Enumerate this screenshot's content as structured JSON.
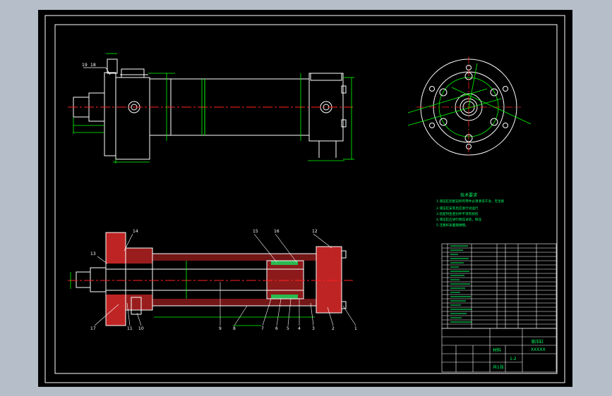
{
  "colors": {
    "window_bg": "#b5bec9",
    "canvas": "#000000",
    "outline": "#ffffff",
    "dimension": "#00ff00",
    "centerline": "#ff2020",
    "hatch": "#ff4040",
    "text_green": "#00ff66",
    "text_white": "#ffffff"
  },
  "top_view_labels": {
    "leader_19": "19",
    "leader_18": "18"
  },
  "section_view_labels": {
    "top": [
      "14",
      "15",
      "16",
      "12"
    ],
    "left": [
      "13"
    ],
    "bottom": [
      "17",
      "11",
      "10",
      "9",
      "8",
      "7",
      "6",
      "5",
      "4",
      "3",
      "2",
      "1"
    ]
  },
  "tech_requirements": {
    "title": "技术要求",
    "lines": [
      "1.液压缸装配前所有零件必须清洗干净，无毛刺",
      "2.液压缸安装后应进行试运行",
      "3.装配时各密封件不得有损伤",
      "4.液压缸应进行耐压试验，保压",
      "5.活塞杆表面镀硬铬。"
    ]
  },
  "title_block": {
    "company": "XXXXX",
    "drawing_name": "液压缸",
    "scale": "1:2",
    "material_label": "材料",
    "sheet": "共1张"
  },
  "icons": [
    "cad-front-view-icon",
    "cad-end-view-icon",
    "cad-section-view-icon"
  ]
}
